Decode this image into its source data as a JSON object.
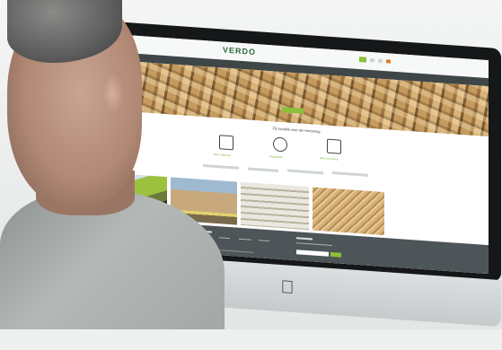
{
  "site": {
    "logo": "VERDO",
    "tagline": "Få overblik over din forretning",
    "nav_items": [
      "",
      "",
      "",
      "",
      ""
    ],
    "icons": [
      {
        "icon": "document-icon",
        "label": "Mine fakturaer"
      },
      {
        "icon": "handshake-icon",
        "label": "Dagsaftaler"
      },
      {
        "icon": "box-icon",
        "label": "Mine leverancer"
      }
    ]
  },
  "colors": {
    "brand_green": "#8bbf3c",
    "logo_dark_green": "#2f6a3a",
    "footer_bg": "#4d5558",
    "bezel": "#151718"
  }
}
